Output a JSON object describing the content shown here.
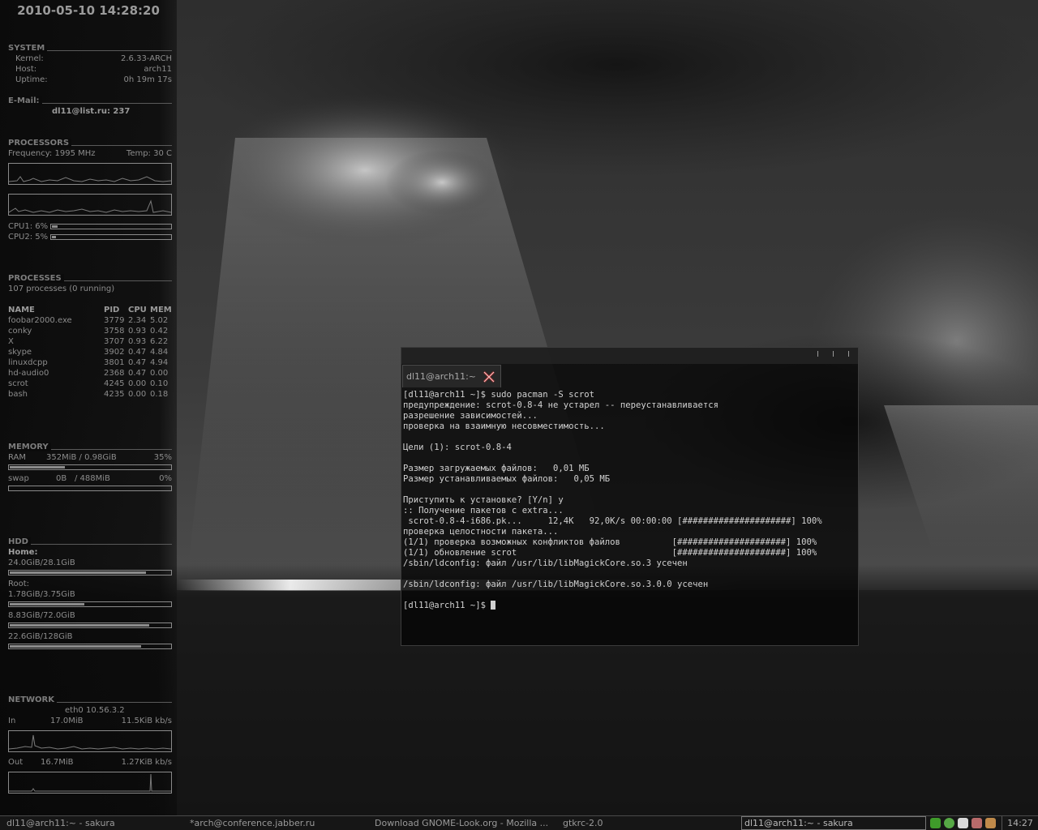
{
  "conky": {
    "datetime": "2010-05-10 14:28:20",
    "system": {
      "heading": "SYSTEM",
      "kernel_label": "Kernel:",
      "kernel": "2.6.33-ARCH",
      "host_label": "Host:",
      "host": "arch11",
      "uptime_label": "Uptime:",
      "uptime": "0h 19m 17s"
    },
    "email": {
      "heading": "E-Mail:",
      "value": "dl11@list.ru: 237"
    },
    "processors": {
      "heading": "PROCESSORS",
      "frequency": "Frequency: 1995 MHz",
      "temp": "Temp: 30 C",
      "cpu1_label": "CPU1: 6%",
      "cpu1_percent": 6,
      "cpu2_label": "CPU2: 5%",
      "cpu2_percent": 5
    },
    "processes": {
      "heading": "PROCESSES",
      "summary": "107 processes (0 running)",
      "columns": [
        "NAME",
        "PID",
        "CPU",
        "MEM"
      ],
      "rows": [
        [
          "foobar2000.exe",
          "3779",
          "2.34",
          "5.02"
        ],
        [
          "conky",
          "3758",
          "0.93",
          "0.42"
        ],
        [
          "X",
          "3707",
          "0.93",
          "6.22"
        ],
        [
          "skype",
          "3902",
          "0.47",
          "4.84"
        ],
        [
          "linuxdcpp",
          "3801",
          "0.47",
          "4.94"
        ],
        [
          "hd-audio0",
          "2368",
          "0.47",
          "0.00"
        ],
        [
          "scrot",
          "4245",
          "0.00",
          "0.10"
        ],
        [
          "bash",
          "4235",
          "0.00",
          "0.18"
        ]
      ]
    },
    "memory": {
      "heading": "MEMORY",
      "ram_label": "RAM",
      "ram_value": "352MiB / 0.98GiB",
      "ram_percent_text": "35%",
      "ram_percent": 35,
      "swap_label": "swap",
      "swap_used": "0B",
      "swap_total": "/ 488MiB",
      "swap_percent_text": "0%",
      "swap_percent": 0
    },
    "hdd": {
      "heading": "HDD",
      "home_label": "Home:",
      "home_value": "24.0GiB/28.1GiB",
      "home_percent": 85,
      "root_label": "Root:",
      "root_value": "1.78GiB/3.75GiB",
      "root_percent": 47,
      "disk3_value": "8.83GiB/72.0GiB",
      "disk3_percent": 87,
      "disk4_value": "22.6GiB/128GiB",
      "disk4_percent": 82
    },
    "network": {
      "heading": "NETWORK",
      "iface": "eth0 10.56.3.2",
      "in_label": "In",
      "in_total": "17.0MiB",
      "in_speed": "11.5KiB kb/s",
      "out_label": "Out",
      "out_total": "16.7MiB",
      "out_speed": "1.27KiB kb/s"
    }
  },
  "terminal": {
    "tab_label": "dl11@arch11:~",
    "lines": [
      "[dl11@arch11 ~]$ sudo pacman -S scrot",
      "предупреждение: scrot-0.8-4 не устарел -- переустанавливается",
      "разрешение зависимостей...",
      "проверка на взаимную несовместимость...",
      "",
      "Цели (1): scrot-0.8-4",
      "",
      "Размер загружаемых файлов:   0,01 МБ",
      "Размер устанавливаемых файлов:   0,05 МБ",
      "",
      "Приступить к установке? [Y/n] y",
      ":: Получение пакетов с extra...",
      " scrot-0.8-4-i686.pk...     12,4K   92,0K/s 00:00:00 [#####################] 100%",
      "проверка целостности пакета...",
      "(1/1) проверка возможных конфликтов файлов          [#####################] 100%",
      "(1/1) обновление scrot                              [#####################] 100%",
      "/sbin/ldconfig: файл /usr/lib/libMagickCore.so.3 усечен",
      "",
      "/sbin/ldconfig: файл /usr/lib/libMagickCore.so.3.0.0 усечен",
      ""
    ],
    "prompt": "[dl11@arch11 ~]$ "
  },
  "taskbar": {
    "tasks": [
      "dl11@arch11:~ - sakura",
      "*arch@conference.jabber.ru",
      "Download GNOME-Look.org - Mozilla ...",
      "gtkrc-2.0",
      "dl11@arch11:~ - sakura"
    ],
    "clock": "14:27"
  }
}
